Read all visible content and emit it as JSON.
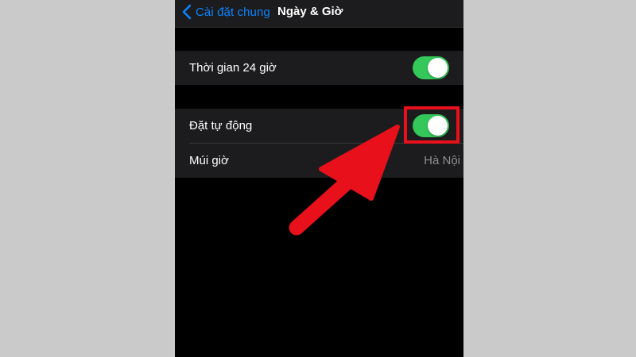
{
  "nav": {
    "back_label": "Cài đặt chung",
    "title": "Ngày & Giờ"
  },
  "settings": {
    "time_24h": {
      "label": "Thời gian 24 giờ",
      "enabled": true
    },
    "set_auto": {
      "label": "Đặt tự động",
      "enabled": true
    },
    "time_zone": {
      "label": "Múi giờ",
      "value": "Hà Nội"
    }
  },
  "colors": {
    "toggle_on": "#34c759",
    "accent": "#0a84ff",
    "annotation": "#e8101a"
  },
  "icons": [
    "chevron-left-icon",
    "arrow-icon"
  ]
}
